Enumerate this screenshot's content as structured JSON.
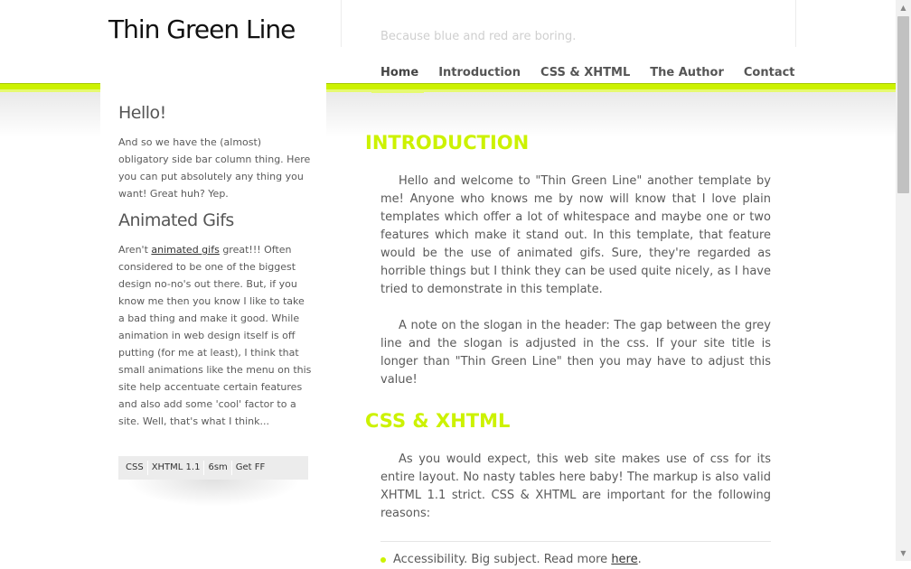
{
  "header": {
    "site_title": "Thin Green Line",
    "slogan": "Because blue and red are boring."
  },
  "nav": {
    "items": [
      "Home",
      "Introduction",
      "CSS & XHTML",
      "The Author",
      "Contact"
    ],
    "active": "Home"
  },
  "sidebar": {
    "hello_heading": "Hello!",
    "hello_text": "And so we have the (almost) obligatory side bar column thing. Here you can put absolutely any thing you want! Great huh? Yep.",
    "gifs_heading": "Animated Gifs",
    "gifs_text_before": "Aren't ",
    "gifs_link": "animated gifs",
    "gifs_text_after": " great!!! Often considered to be one of the biggest design no-no's out there. But, if you know me then you know I like to take a bad thing and make it good. While animation in web design itself is off putting (for me at least), I think that small animations like the menu on this site help accentuate certain features and also add some 'cool' factor to a site. Well, that's what I think...",
    "badges": [
      "CSS",
      "XHTML 1.1",
      "6sm",
      "Get FF"
    ]
  },
  "main": {
    "intro_heading": "INTRODUCTION",
    "intro_p1": "Hello and welcome to \"Thin Green Line\" another template by me! Anyone who knows me by now will know that I love plain templates which offer a lot of whitespace and maybe one or two features which make it stand out. In this template, that feature would be the use of animated gifs. Sure, they're regarded as horrible things but I think they can be used quite nicely, as I have tried to demonstrate in this template.",
    "intro_p2": "A note on the slogan in the header: The gap between the grey line and the slogan is adjusted in the css. If your site title is longer than \"Thin Green Line\" then you may have to adjust this value!",
    "css_heading": "CSS & XHTML",
    "css_p": "As you would expect, this web site makes use of css for its entire layout. No nasty tables here baby! The markup is also valid XHTML 1.1 strict. CSS & XHTML are important for the following reasons:",
    "list_item_text": "Accessibility. Big subject. Read more ",
    "list_item_link": "here",
    "list_item_end": "."
  },
  "colors": {
    "accent_green": "#ccf200",
    "text_grey": "#5a5a5a"
  }
}
